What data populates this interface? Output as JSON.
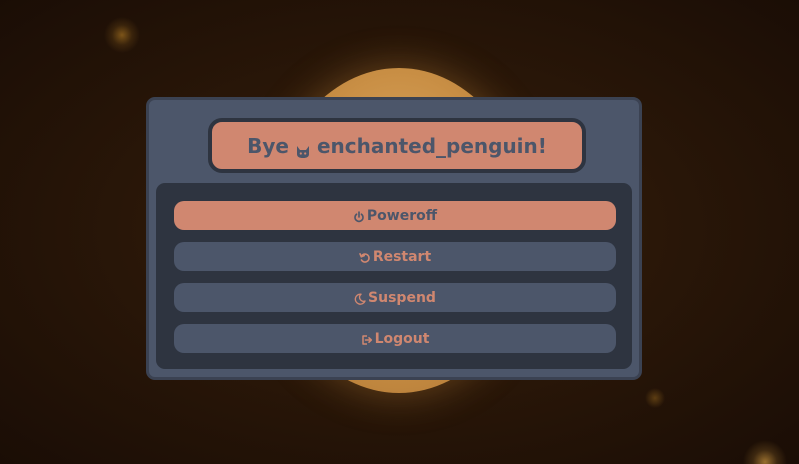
{
  "greeting": {
    "prefix": "Bye",
    "icon": "cat-icon",
    "username": "enchanted_penguin!"
  },
  "menu": {
    "items": [
      {
        "label": "Poweroff",
        "icon": "power-icon",
        "active": true
      },
      {
        "label": "Restart",
        "icon": "restart-icon",
        "active": false
      },
      {
        "label": "Suspend",
        "icon": "moon-icon",
        "active": false
      },
      {
        "label": "Logout",
        "icon": "logout-icon",
        "active": false
      }
    ]
  },
  "colors": {
    "accent": "#d08770",
    "panel": "#4c566a",
    "panel_border": "#3b4252",
    "menu_bg": "#2e3440"
  }
}
